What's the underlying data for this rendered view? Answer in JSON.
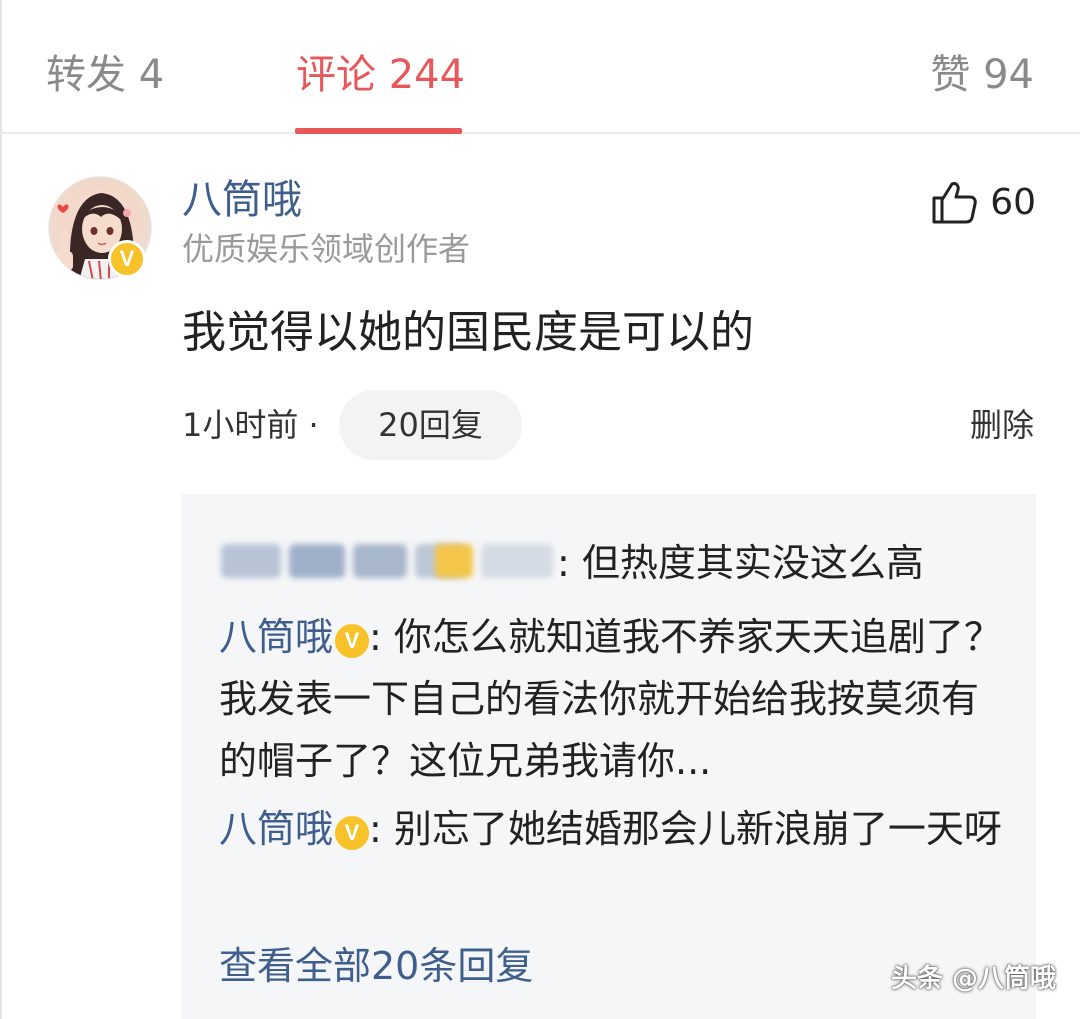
{
  "tabs": {
    "repost": "转发 4",
    "comments": "评论 244",
    "likes": "赞 94"
  },
  "comment": {
    "username": "八筒哦",
    "subtitle": "优质娱乐领域创作者",
    "likes": "60",
    "text": "我觉得以她的国民度是可以的",
    "time": "1小时前 ·",
    "reply_count_label": "20回复",
    "delete_label": "删除",
    "verified_badge": "V"
  },
  "replies": [
    {
      "name": "",
      "name_blurred": true,
      "text": ": 但热度其实没这么高"
    },
    {
      "name": "八筒哦",
      "verified": "V",
      "text": ": 你怎么就知道我不养家天天追剧了？我发表一下自己的看法你就开始给我按莫须有的帽子了？这位兄弟我请你..."
    },
    {
      "name": "八筒哦",
      "verified": "V",
      "text": ": 别忘了她结婚那会儿新浪崩了一天呀"
    }
  ],
  "view_all_label": "查看全部20条回复",
  "watermark": "头条 @八筒哦",
  "colors": {
    "accent": "#e8585a",
    "link": "#3e5f8c",
    "verified": "#f7c22a",
    "reply_bg": "#f5f6f8"
  },
  "icons": {
    "like": "thumbs-up-icon",
    "verified": "verified-v-icon"
  }
}
